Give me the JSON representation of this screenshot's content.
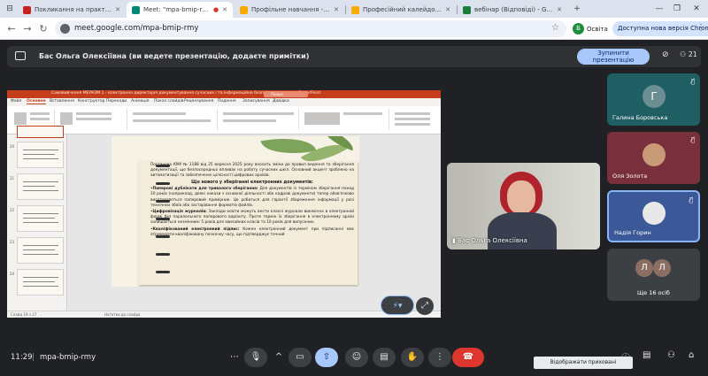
{
  "browser": {
    "tabs": [
      {
        "label": "Покликання на практикум - с",
        "favicon_color": "#c5221f",
        "active": false
      },
      {
        "label": "Meet: \"mpa-bmip-rmy\"",
        "favicon_color": "#00897b",
        "active": true
      },
      {
        "label": "Профільне навчання - lino",
        "favicon_color": "#f9ab00",
        "active": false
      },
      {
        "label": "Професійний калейдоскоп - l",
        "favicon_color": "#f9ab00",
        "active": false
      },
      {
        "label": "вебінар (Відповіді) - Google Та",
        "favicon_color": "#188038",
        "active": false
      }
    ],
    "url": "meet.google.com/mpa-bmip-rmy",
    "profile_initial": "Б",
    "profile_label": "Освіта",
    "update_label": "Доступна нова версія Chrome"
  },
  "banner": {
    "text": "Бас Ольга Олексіївна (ви ведете презентацію, додаєте примітки)",
    "stop_line1": "Зупинити",
    "stop_line2": "презентацію",
    "people_count": "21"
  },
  "ppt": {
    "title": "Самовивчення МЕУКЗМ 1 - електронна директорія документування сучасних і та інформаційна безпека посилання - PowerPoint",
    "search_label": "Пошук",
    "menu": [
      "Файл",
      "Основне",
      "Вставлення",
      "Конструктор",
      "Переходи",
      "Анімація",
      "Показ слайдів",
      "Рецензування",
      "Подання",
      "Записування",
      "Довідка"
    ],
    "active_menu": "Основне",
    "slide_numbers": [
      "20",
      "21",
      "22",
      "23",
      "24"
    ],
    "status": "Слайд 19 з 27",
    "notes": "Нотатки до слайда",
    "slide": {
      "p1": "Постанова КМУ № 1188 від 25 вересня 2025 року вносить зміни до правил ведення та зберігання документації, що безпосередньо впливає на роботу сучасних шкіл. Основний акцент зроблено на автоматизації та забезпеченні цілісності цифрових архівів.",
      "heading": "Що нового у зберіганні електронних документів:",
      "b1_label": "Паперові дублікати для тривалого зберігання:",
      "b1_text": "Для документів із терміном зберігання понад 10 років (наприклад, деякі накази з основної діяльності або кадрові документи) тепер обов'язково виготовляється паперовий примірник. Це робиться для гарантії збереження інформації у разі технічних збоїв або застарівання форматів файлів.",
      "b2_label": "Цифровізація журналів:",
      "b2_text": "Заклади освіти можуть вести класні журнали виключно в електронній формі без паралельного паперового варіанту. Проте термін їх зберігання в електронному архіві залишається незмінним: 5 років для звичайних класів та 10 років для випускних.",
      "b3_label": "Кваліфікований електронний підпис:",
      "b3_text": "Кожен електронний документ при підписанні має отримувати кваліфіковану позначку часу, що підтверджує точний"
    }
  },
  "presenter": {
    "name": "Бас Ольга Олексіївна"
  },
  "participants": [
    {
      "name": "Галина Боровська",
      "initial": "Г",
      "bg": "#1f5e63",
      "avatar_bg": "#6b8e92"
    },
    {
      "name": "Оля Золота",
      "initial": "",
      "bg": "#7a2f3c",
      "avatar_bg": "#c99a78"
    },
    {
      "name": "Надія Горин",
      "initial": "",
      "bg": "#3b5998",
      "avatar_bg": "#e8e8e8"
    },
    {
      "name": "Ще 16 осіб",
      "initial": "Л",
      "bg": "#3c4043",
      "avatar_bg": "#8d6e63"
    }
  ],
  "bottom": {
    "time": "11:29",
    "separator": "|",
    "meeting_code": "mpa-bmip-rmy",
    "tooltip": "Відображати приховані піктограми"
  }
}
